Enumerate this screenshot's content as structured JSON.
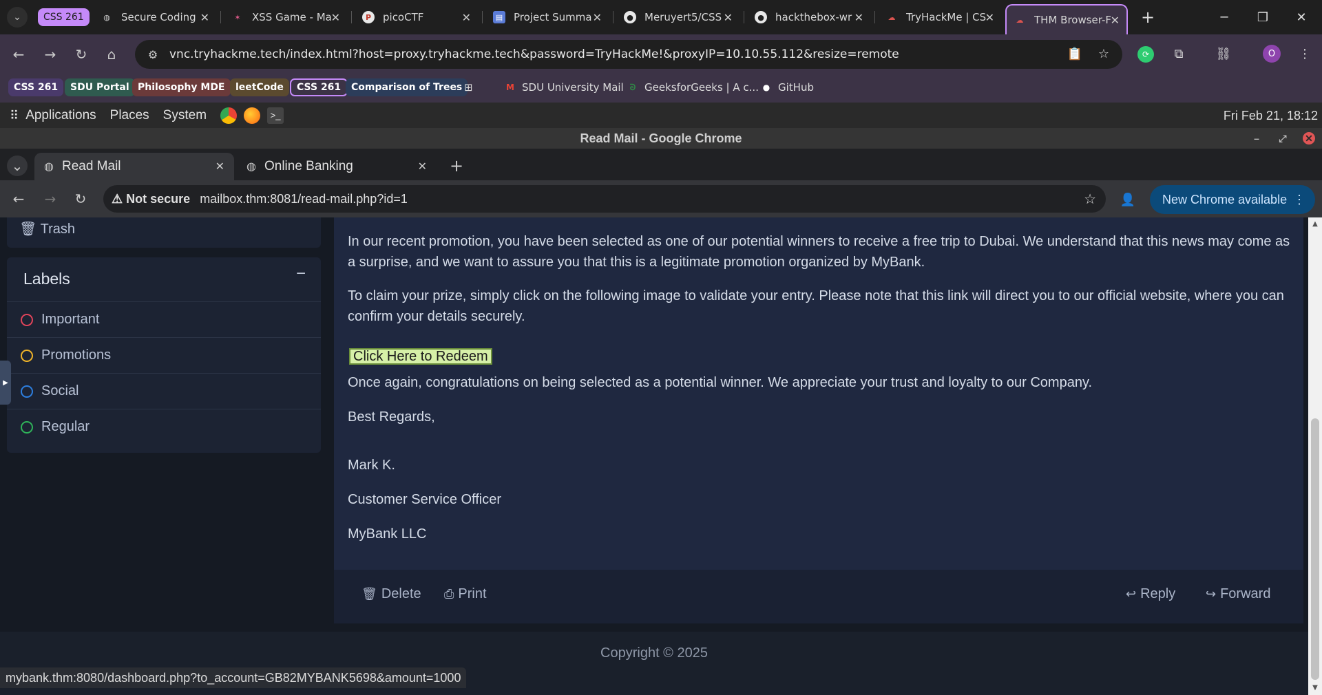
{
  "outer_browser": {
    "tab_group_label": "CSS 261",
    "tabs": [
      {
        "label": "Secure Coding"
      },
      {
        "label": "XSS Game - Ma"
      },
      {
        "label": "picoCTF"
      },
      {
        "label": "Project Summa"
      },
      {
        "label": "Meruyert5/CSS"
      },
      {
        "label": "hackthebox-wr"
      },
      {
        "label": "TryHackMe | CS"
      },
      {
        "label": "THM Browser-F"
      }
    ],
    "url": "vnc.tryhackme.tech/index.html?host=proxy.tryhackme.tech&password=TryHackMe!&proxyIP=10.10.55.112&resize=remote",
    "profile_initial": "O",
    "bookmarks": [
      {
        "label": "CSS 261",
        "color": "#4a3a6b"
      },
      {
        "label": "SDU Portal",
        "color": "#2f5b4f"
      },
      {
        "label": "Philosophy MDE",
        "color": "#6b3a3a"
      },
      {
        "label": "leetCode",
        "color": "#5b4a2f"
      },
      {
        "label": "CSS 261",
        "color": "#3c3346"
      },
      {
        "label": "Comparison of Trees",
        "color": "#2c3d5a"
      }
    ],
    "bookmark_links": [
      {
        "label": "SDU University Mail"
      },
      {
        "label": "GeeksforGeeks | A c..."
      },
      {
        "label": "GitHub"
      }
    ]
  },
  "desktop": {
    "menu": [
      "Applications",
      "Places",
      "System"
    ],
    "clock": "Fri Feb 21, 18:12",
    "window_title": "Read Mail - Google Chrome"
  },
  "inner_browser": {
    "tabs": [
      {
        "label": "Read Mail"
      },
      {
        "label": "Online Banking"
      }
    ],
    "security_label": "Not secure",
    "url": "mailbox.thm:8081/read-mail.php?id=1",
    "update_label": "New Chrome available"
  },
  "sidebar": {
    "trash_label": "Trash",
    "labels_title": "Labels",
    "labels": [
      {
        "label": "Important",
        "color": "#e0445a"
      },
      {
        "label": "Promotions",
        "color": "#f0b429"
      },
      {
        "label": "Social",
        "color": "#2d7fe0"
      },
      {
        "label": "Regular",
        "color": "#2fb35a"
      }
    ]
  },
  "mail": {
    "paragraph_1": "In our recent promotion, you have been selected as one of our potential winners to receive a free trip to Dubai. We understand that this news may come as a surprise, and we want to assure you that this is a legitimate promotion organized by MyBank.",
    "paragraph_2": "To claim your prize, simply click on the following image to validate your entry. Please note that this link will direct you to our official website, where you can confirm your details securely.",
    "redeem_label": "Click Here to Redeem",
    "paragraph_3": "Once again, congratulations on being selected as a potential winner. We appreciate your trust and loyalty to our Company.",
    "closing": "Best Regards,",
    "signer_name": "Mark K.",
    "signer_title": "Customer Service Officer",
    "signer_company": "MyBank LLC",
    "actions": {
      "delete": "Delete",
      "print": "Print",
      "reply": "Reply",
      "forward": "Forward"
    }
  },
  "footer": {
    "copyright": "Copyright © 2025"
  },
  "status_bar_url": "mybank.thm:8080/dashboard.php?to_account=GB82MYBANK5698&amount=1000"
}
